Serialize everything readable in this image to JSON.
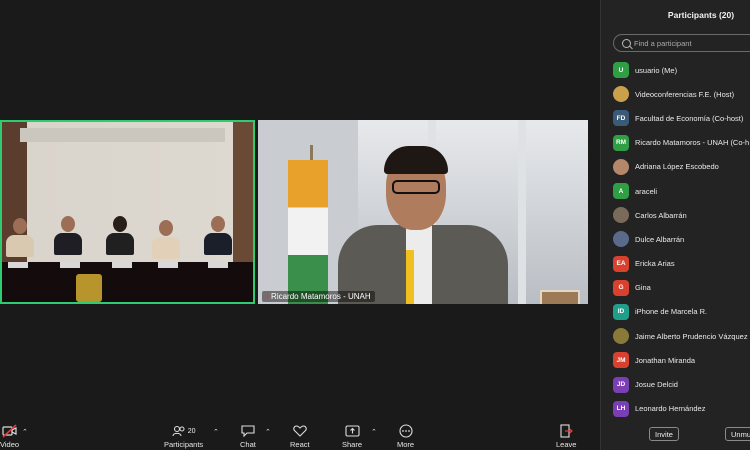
{
  "tiles": {
    "left_name": "",
    "right_name": "Ricardo Matamoros - UNAH"
  },
  "toolbar": {
    "video_label": "Video",
    "participants_label": "Participants",
    "participants_count": "20",
    "chat_label": "Chat",
    "react_label": "React",
    "share_label": "Share",
    "more_label": "More",
    "leave_label": "Leave"
  },
  "panel": {
    "title": "Participants (20)",
    "search_placeholder": "Find a participant",
    "invite_label": "Invite",
    "unmute_label": "Unmu",
    "participants": [
      {
        "initials": "U",
        "name": "usuario (Me)",
        "color": "#2f9e44",
        "photo": false
      },
      {
        "initials": "",
        "name": "Videoconferencias F.E. (Host)",
        "color": "#c9a14a",
        "photo": true
      },
      {
        "initials": "FD",
        "name": "Facultad de Economía (Co-host)",
        "color": "#3a5a78",
        "photo": false
      },
      {
        "initials": "RM",
        "name": "Ricardo Matamoros - UNAH (Co-h",
        "color": "#2f9e44",
        "photo": false
      },
      {
        "initials": "",
        "name": "Adriana López Escobedo",
        "color": "#b5876a",
        "photo": true
      },
      {
        "initials": "A",
        "name": "araceli",
        "color": "#2f9e44",
        "photo": false
      },
      {
        "initials": "",
        "name": "Carlos Albarrán",
        "color": "#7a6a5a",
        "photo": true
      },
      {
        "initials": "",
        "name": "Dulce Albarrán",
        "color": "#5a6a8a",
        "photo": true
      },
      {
        "initials": "EA",
        "name": "Ericka Arias",
        "color": "#d9412f",
        "photo": false
      },
      {
        "initials": "G",
        "name": "Gina",
        "color": "#d9412f",
        "photo": false
      },
      {
        "initials": "ID",
        "name": "iPhone de Marcela  R.",
        "color": "#1f9e8a",
        "photo": false
      },
      {
        "initials": "",
        "name": "Jaime Alberto Prudencio Vázquez",
        "color": "#8a7a3a",
        "photo": true
      },
      {
        "initials": "JM",
        "name": "Jonathan Miranda",
        "color": "#d9412f",
        "photo": false
      },
      {
        "initials": "JD",
        "name": "Josue Delcid",
        "color": "#7b3fb5",
        "photo": false
      },
      {
        "initials": "LH",
        "name": "Leonardo Hernández",
        "color": "#7b3fb5",
        "photo": false
      }
    ]
  }
}
